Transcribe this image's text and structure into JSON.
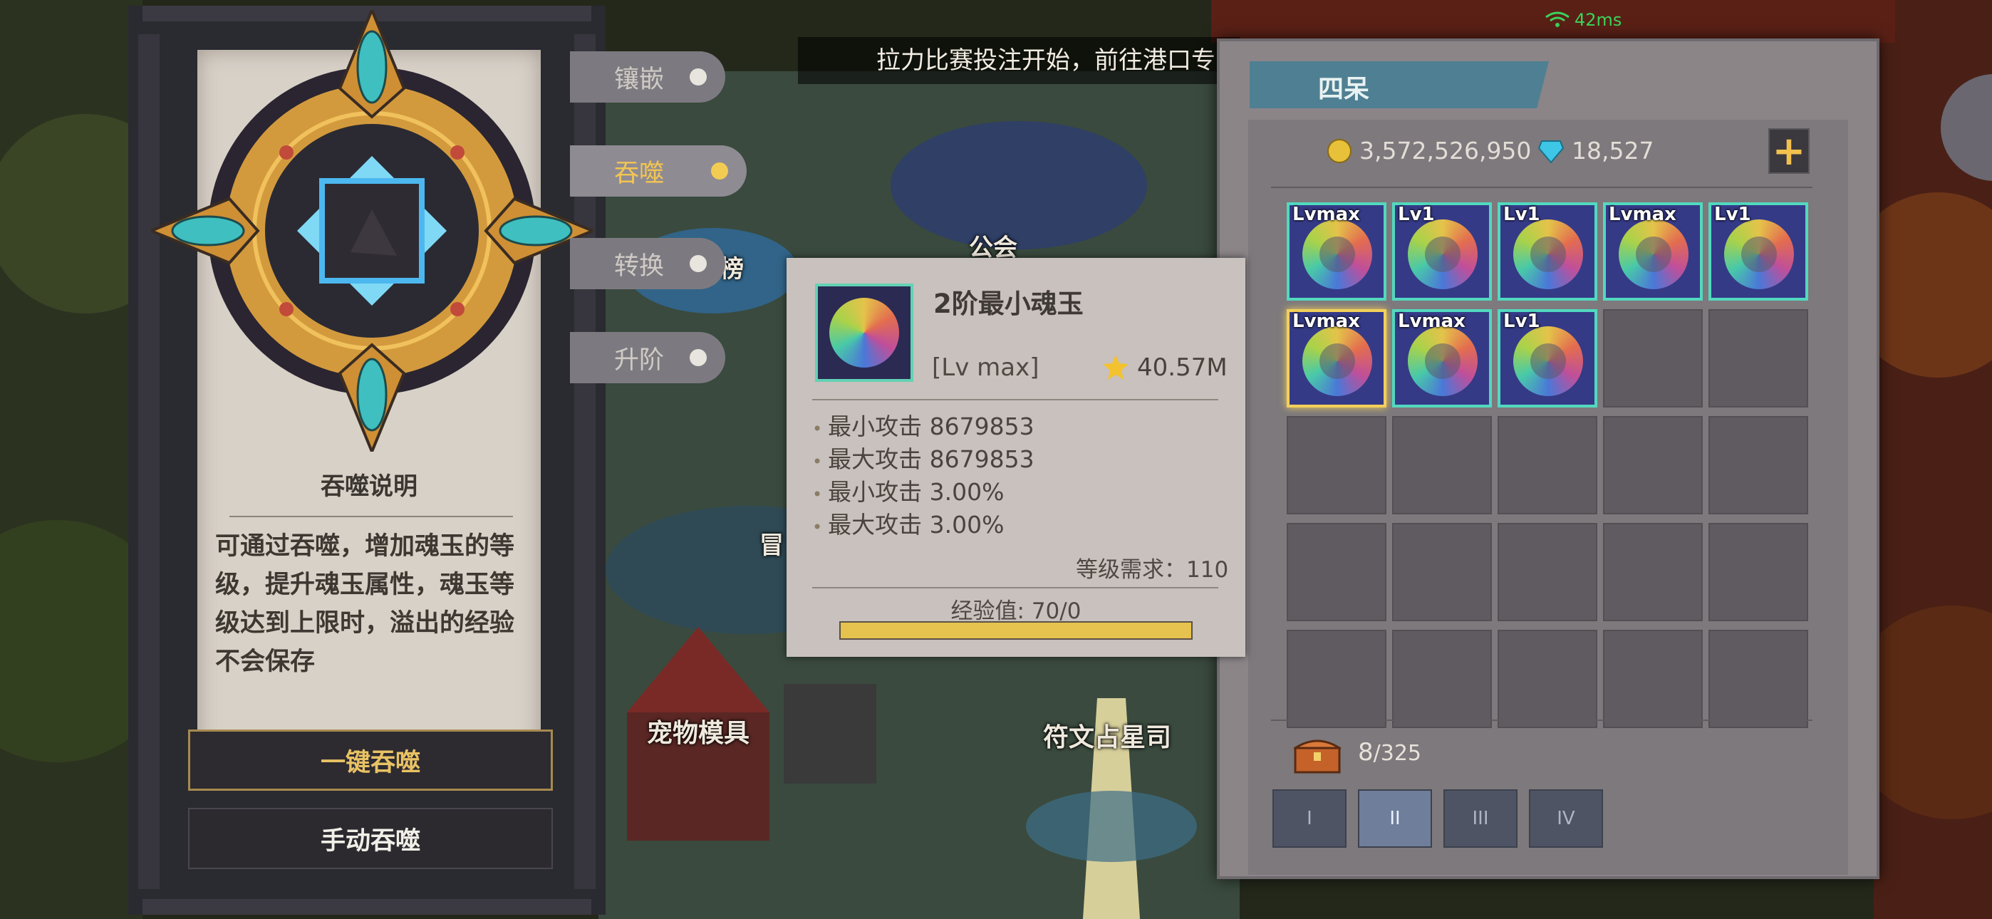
{
  "marquee": "拉力比赛投注开始，前往港口专",
  "network": {
    "latency": "42ms"
  },
  "left_panel": {
    "desc_title": "吞噬说明",
    "desc_text": "可通过吞噬，增加魂玉的等级，提升魂玉属性，魂玉等级达到上限时，溢出的经验不会保存",
    "btn_auto": "一键吞噬",
    "btn_manual": "手动吞噬"
  },
  "side_tabs": [
    {
      "label": "镶嵌",
      "active": false
    },
    {
      "label": "吞噬",
      "active": true
    },
    {
      "label": "转换",
      "active": false
    },
    {
      "label": "升阶",
      "active": false
    }
  ],
  "map_labels": {
    "guild": "公会",
    "pet_model": "宠物模具",
    "rune": "符文占星司",
    "partial_1": "榜",
    "partial_2": "冒"
  },
  "tooltip": {
    "name": "2阶最小魂玉",
    "level": "[Lv max]",
    "score": "40.57M",
    "stats": [
      "最小攻击 8679853",
      "最大攻击 8679853",
      "最小攻击 3.00%",
      "最大攻击 3.00%"
    ],
    "level_req": "等级需求：110",
    "exp_label": "经验值: 70/0",
    "exp_progress": 1.0
  },
  "inventory": {
    "tab_label": "四呆",
    "gold": "3,572,526,950",
    "gems": "18,527",
    "items": [
      {
        "lv": "Lvmax",
        "selected": false
      },
      {
        "lv": "Lv1",
        "selected": false
      },
      {
        "lv": "Lv1",
        "selected": false
      },
      {
        "lv": "Lvmax",
        "selected": false
      },
      {
        "lv": "Lv1",
        "selected": false
      },
      {
        "lv": "Lvmax",
        "selected": true
      },
      {
        "lv": "Lvmax",
        "selected": false
      },
      {
        "lv": "Lv1",
        "selected": false
      }
    ],
    "capacity_used": "8",
    "capacity_total": "/325",
    "category_tabs": [
      "I",
      "II",
      "III",
      "IV"
    ],
    "active_category": 1
  },
  "colors": {
    "accent_gold": "#f2c552",
    "item_border": "#52d9bf",
    "panel": "#8b8588"
  }
}
